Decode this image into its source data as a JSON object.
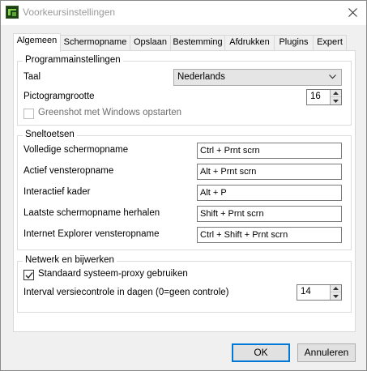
{
  "window": {
    "title": "Voorkeursinstellingen",
    "app_icon": "greenshot-icon",
    "close_icon": "close-icon"
  },
  "tabs": [
    {
      "label": "Algemeen",
      "active": true
    },
    {
      "label": "Schermopname",
      "active": false
    },
    {
      "label": "Opslaan",
      "active": false
    },
    {
      "label": "Bestemming",
      "active": false
    },
    {
      "label": "Afdrukken",
      "active": false
    },
    {
      "label": "Plugins",
      "active": false
    },
    {
      "label": "Expert",
      "active": false
    }
  ],
  "program_settings": {
    "title": "Programmainstellingen",
    "language_label": "Taal",
    "language_value": "Nederlands",
    "icon_size_label": "Pictogramgrootte",
    "icon_size_value": "16",
    "autostart_label": "Greenshot met Windows opstarten",
    "autostart_checked": false
  },
  "hotkeys": {
    "title": "Sneltoetsen",
    "items": [
      {
        "label": "Volledige schermopname",
        "value": "Ctrl + Prnt scrn"
      },
      {
        "label": "Actief vensteropname",
        "value": "Alt + Prnt scrn"
      },
      {
        "label": "Interactief kader",
        "value": "Alt + P"
      },
      {
        "label": "Laatste schermopname herhalen",
        "value": "Shift + Prnt scrn"
      },
      {
        "label": "Internet Explorer vensteropname",
        "value": "Ctrl + Shift + Prnt scrn"
      }
    ]
  },
  "network": {
    "title": "Netwerk en bijwerken",
    "proxy_label": "Standaard systeem-proxy gebruiken",
    "proxy_checked": true,
    "interval_label": "Interval versiecontrole in dagen (0=geen controle)",
    "interval_value": "14"
  },
  "buttons": {
    "ok": "OK",
    "cancel": "Annuleren"
  }
}
